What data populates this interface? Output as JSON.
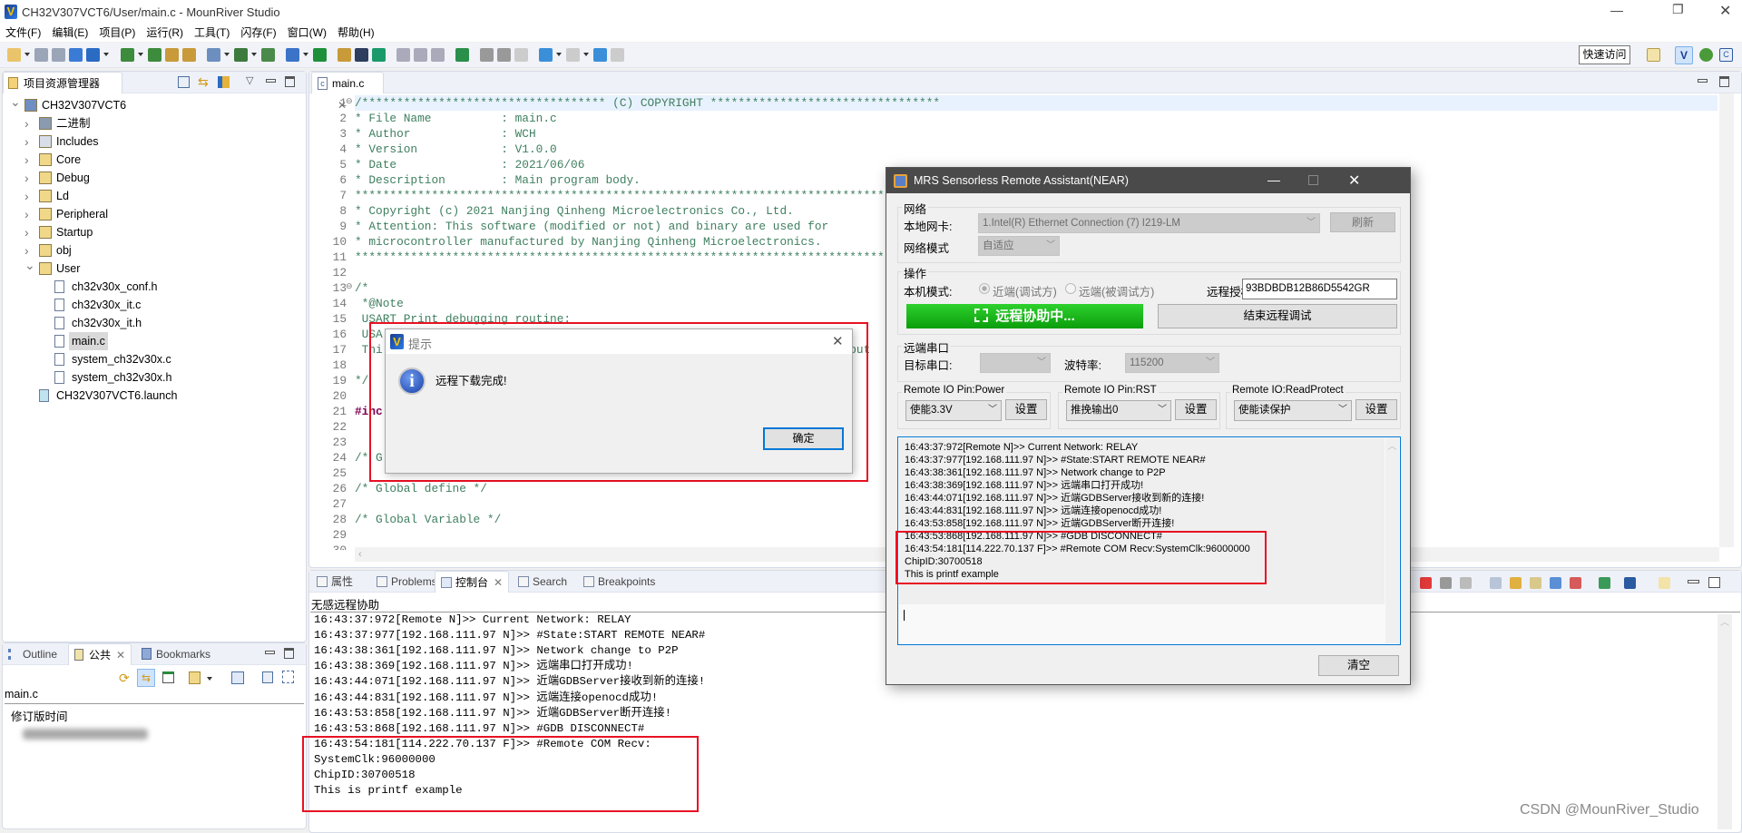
{
  "window": {
    "title": "CH32V307VCT6/User/main.c - MounRiver Studio"
  },
  "menu": [
    "文件(F)",
    "编辑(E)",
    "项目(P)",
    "运行(R)",
    "工具(T)",
    "闪存(F)",
    "窗口(W)",
    "帮助(H)"
  ],
  "toolbar": {
    "icons": [
      "new-icon",
      "save-icon",
      "save-all-icon",
      "new-project-icon",
      "build-config-icon",
      "download-icon",
      "build-icon",
      "build-all-icon",
      "import-icon",
      "export-icon",
      "debug-icon",
      "run-icon",
      "search-icon",
      "ld-file-icon",
      "help-icon",
      "terminal-icon",
      "k-icon",
      "indent-icon",
      "outdent-icon",
      "format-icon",
      "task-icon",
      "prev-annotation-icon",
      "next-annotation-icon",
      "last-edit-icon",
      "back-icon",
      "forward-icon",
      "pin-icon",
      "unpin-icon"
    ],
    "quick_access": "快速访问"
  },
  "explorer": {
    "tab_label": "项目资源管理器",
    "items": [
      {
        "label": "CH32V307VCT6",
        "level": 0,
        "state": "expanded",
        "icon": "project-icon"
      },
      {
        "label": "二进制",
        "level": 1,
        "state": "collapsed",
        "icon": "binaries-icon"
      },
      {
        "label": "Includes",
        "level": 1,
        "state": "collapsed",
        "icon": "includes-icon"
      },
      {
        "label": "Core",
        "level": 1,
        "state": "collapsed",
        "icon": "source-folder-icon"
      },
      {
        "label": "Debug",
        "level": 1,
        "state": "collapsed",
        "icon": "source-folder-icon"
      },
      {
        "label": "Ld",
        "level": 1,
        "state": "collapsed",
        "icon": "source-folder-icon"
      },
      {
        "label": "Peripheral",
        "level": 1,
        "state": "collapsed",
        "icon": "source-folder-icon"
      },
      {
        "label": "Startup",
        "level": 1,
        "state": "collapsed",
        "icon": "source-folder-icon"
      },
      {
        "label": "obj",
        "level": 1,
        "state": "collapsed",
        "icon": "folder-icon"
      },
      {
        "label": "User",
        "level": 1,
        "state": "expanded",
        "icon": "folder-icon"
      },
      {
        "label": "ch32v30x_conf.h",
        "level": 2,
        "state": "leaf",
        "icon": "h-file-icon"
      },
      {
        "label": "ch32v30x_it.c",
        "level": 2,
        "state": "leaf",
        "icon": "c-file-icon"
      },
      {
        "label": "ch32v30x_it.h",
        "level": 2,
        "state": "leaf",
        "icon": "h-file-icon"
      },
      {
        "label": "main.c",
        "level": 2,
        "state": "selected",
        "icon": "c-file-icon"
      },
      {
        "label": "system_ch32v30x.c",
        "level": 2,
        "state": "leaf",
        "icon": "c-file-icon"
      },
      {
        "label": "system_ch32v30x.h",
        "level": 2,
        "state": "leaf",
        "icon": "h-file-icon"
      },
      {
        "label": "CH32V307VCT6.launch",
        "level": 1,
        "state": "leaf",
        "icon": "launch-file-icon"
      }
    ]
  },
  "outline": {
    "tabs": [
      "Outline",
      "公共",
      "Bookmarks"
    ],
    "active_tab": 1,
    "file": "main.c",
    "column_header": "修订版时间"
  },
  "editor": {
    "tab_label": "main.c",
    "lines": [
      "/*********************************** (C) COPYRIGHT *********************************",
      "* File Name          : main.c",
      "* Author             : WCH",
      "* Version            : V1.0.0",
      "* Date               : 2021/06/06",
      "* Description        : Main program body.",
      "*********************************************************************************************************",
      "* Copyright (c) 2021 Nanjing Qinheng Microelectronics Co., Ltd.",
      "* Attention: This software (modified or not) and binary are used for",
      "* microcontroller manufactured by Nanjing Qinheng Microelectronics.",
      "*********************************************************************************************************",
      "",
      "/*",
      " *@Note",
      " USART Print debugging routine:",
      " USA",
      " Thi                                                                  tput",
      "",
      "*/",
      "",
      "#inc",
      "",
      "",
      "/* G",
      "",
      "/* Global define */",
      "",
      "/* Global Variable */",
      ""
    ]
  },
  "dialog": {
    "title": "提示",
    "message": "远程下载完成!",
    "ok": "确定"
  },
  "remote": {
    "title": "MRS Sensorless Remote Assistant(NEAR)",
    "network": {
      "group": "网络",
      "nic_label": "本地网卡:",
      "nic_value": "1.Intel(R) Ethernet Connection (7) I219-LM",
      "refresh": "刷新",
      "mode_label": "网络模式",
      "mode_value": "自适应"
    },
    "operation": {
      "group": "操作",
      "mode_label": "本机模式:",
      "radio_near": "近端(调试方)",
      "radio_far": "远端(被调试方)",
      "selected": "near",
      "auth_label": "远程授权码:",
      "auth_value": "93BDBDB12B86D5542GR",
      "assist_button": "远程协助中...",
      "end_button": "结束远程调试"
    },
    "serial": {
      "group": "远端串口",
      "port_label": "目标串口:",
      "port_value": "",
      "baud_label": "波特率:",
      "baud_value": "115200"
    },
    "io": [
      {
        "title": "Remote IO Pin:Power",
        "value": "使能3.3V",
        "set": "设置"
      },
      {
        "title": "Remote IO Pin:RST",
        "value": "推挽输出0",
        "set": "设置"
      },
      {
        "title": "Remote IO:ReadProtect",
        "value": "使能读保护",
        "set": "设置"
      }
    ],
    "log": [
      "16:43:37:972[Remote N]>> Current Network: RELAY",
      "16:43:37:977[192.168.111.97 N]>> #State:START REMOTE NEAR#",
      "16:43:38:361[192.168.111.97 N]>> Network change to P2P",
      "16:43:38:369[192.168.111.97 N]>> 远端串口打开成功!",
      "16:43:44:071[192.168.111.97 N]>> 近端GDBServer接收到新的连接!",
      "16:43:44:831[192.168.111.97 N]>> 远端连接openocd成功!",
      "16:43:53:858[192.168.111.97 N]>> 近端GDBServer断开连接!",
      "16:43:53:868[192.168.111.97 N]>> #GDB DISCONNECT#",
      "16:43:54:181[114.222.70.137 F]>> #Remote COM Recv:SystemClk:96000000",
      "ChipID:30700518",
      "This is printf example"
    ],
    "clear": "清空"
  },
  "bottom": {
    "tabs": [
      "属性",
      "Problems",
      "控制台",
      "Search",
      "Breakpoints"
    ],
    "active_tab": 2,
    "console_title": "无感远程协助",
    "console_lines": [
      "16:43:37:972[Remote N]>> Current Network: RELAY",
      "16:43:37:977[192.168.111.97 N]>> #State:START REMOTE NEAR#",
      "16:43:38:361[192.168.111.97 N]>> Network change to P2P",
      "16:43:38:369[192.168.111.97 N]>> 远端串口打开成功!",
      "16:43:44:071[192.168.111.97 N]>> 近端GDBServer接收到新的连接!",
      "16:43:44:831[192.168.111.97 N]>> 远端连接openocd成功!",
      "16:43:53:858[192.168.111.97 N]>> 近端GDBServer断开连接!",
      "16:43:53:868[192.168.111.97 N]>> #GDB DISCONNECT#",
      "16:43:54:181[114.222.70.137 F]>> #Remote COM Recv:",
      "SystemClk:96000000",
      "ChipID:30700518",
      "This is printf example"
    ]
  },
  "watermark": "CSDN @MounRiver_Studio",
  "colors": {
    "comment": "#3f7f5f",
    "keyword": "#7f0055",
    "highlight_box": "#e81123",
    "assist_green": "#19b419",
    "remote_titlebar": "#4a4a4a"
  }
}
